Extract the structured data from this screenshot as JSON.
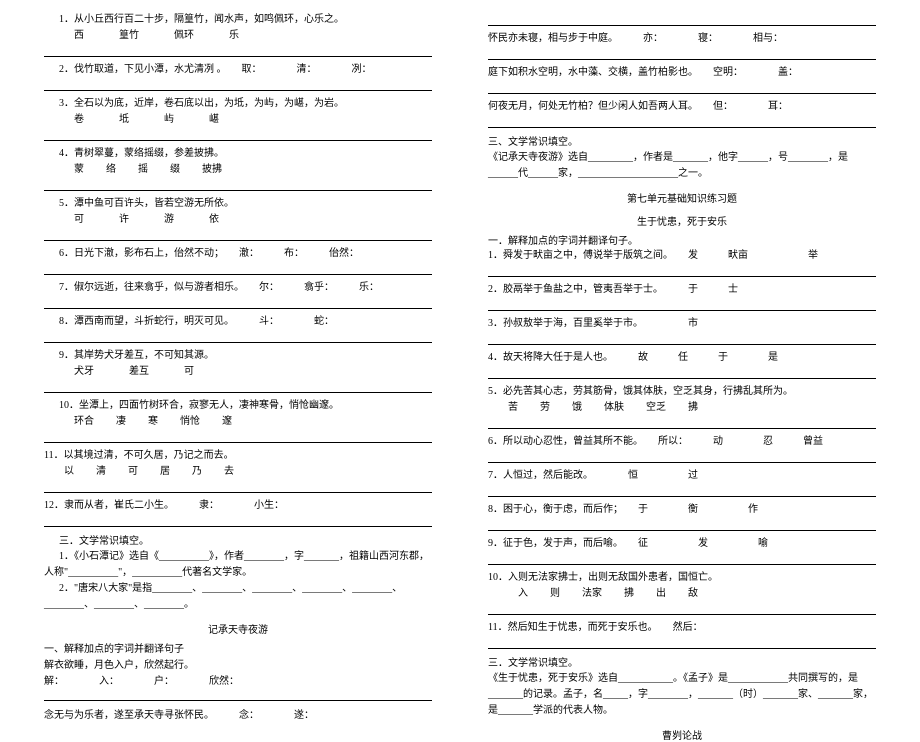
{
  "left": {
    "q1": {
      "text": "1．从小丘西行百二十步，隔篁竹，闻水声，如鸣佩环，心乐之。",
      "sub": [
        "西",
        "篁竹",
        "佩环",
        "乐"
      ]
    },
    "q2": {
      "text": "2．伐竹取道，下见小潭，水尤清冽 。　　取：　　　　清：　　　　冽：",
      "sub": []
    },
    "q3": {
      "text": "3．全石以为底，近岸，卷石底以出，为坻，为屿，为嵁，为岩。",
      "sub": [
        "卷",
        "坻",
        "屿",
        "嵁"
      ]
    },
    "q4": {
      "text": "4．青树翠蔓，蒙络摇缀，参差披拂。",
      "sub": [
        "蒙",
        "络",
        "摇",
        "缀",
        "披拂"
      ]
    },
    "q5": {
      "text": "5．潭中鱼可百许头，皆若空游无所依。",
      "sub": [
        "可",
        "许",
        "游",
        "依"
      ]
    },
    "q6": {
      "text": "6．日光下澈，影布石上，佁然不动；　　澈：　　　布：　　　佁然：",
      "sub": []
    },
    "q7": {
      "text": "7．俶尔远逝，往来翕乎，似与游者相乐。　　尔：　　　翕乎：　　　乐：",
      "sub": []
    },
    "q8": {
      "text": "8．潭西南而望，斗折蛇行，明灭可见。　　　斗：　　　　蛇：",
      "sub": []
    },
    "q9": {
      "text": "9．其岸势犬牙差互，不可知其源。",
      "sub": [
        "犬牙",
        "差互",
        "可"
      ]
    },
    "q10": {
      "text": "10．坐潭上，四面竹树环合，寂寥无人，凄神寒骨，悄怆幽邃。",
      "sub": [
        "环合",
        "凄",
        "寒",
        "悄怆",
        "邃"
      ]
    },
    "q11": {
      "text": "11．以其境过清，不可久居，乃记之而去。",
      "sub": [
        "以",
        "清",
        "可",
        "居",
        "乃",
        "去"
      ]
    },
    "q12": {
      "text": "12．隶而从者，崔氏二小生。　　　隶：　　　　小生：",
      "sub": []
    },
    "lit_h": "三．文学常识填空。",
    "lit1": "1．《小石潭记》选自《__________》，作者________，字_______，祖籍山西河东郡，人称\"__________\"，__________代著名文学家。",
    "lit2": "2．\"唐宋八大家\"是指________、________、________、________、________、________、________、________。",
    "title2": "记承天寺夜游",
    "s1": "一、解释加点的字词并翻译句子",
    "s2": "解衣欲睡，月色入户，欣然起行。",
    "s3_labels": "解：　　　　入：　　　　户：　　　　欣然：",
    "s4": "念无与为乐者，遂至承天寺寻张怀民。　　　念：　　　　遂："
  },
  "right": {
    "r1": {
      "text": "怀民亦未寝，相与步于中庭。　　　亦：　　　　寝：　　　　相与："
    },
    "r2": {
      "text": "庭下如积水空明，水中藻、交横，盖竹柏影也。　　空明：　　　　盖："
    },
    "r3": {
      "text": "何夜无月，何处无竹柏？但少闲人如吾两人耳。　　但：　　　　耳："
    },
    "lit_h": "三、文学常识填空。",
    "lit": "《记承天寺夜游》选自_________，作者是_______，他字______，号________，是______代______家，____________________之一。",
    "unit_h": "第七单元基础知识练习题",
    "title3": "生于忧患，死于安乐",
    "s1": "一．解释加点的字词并翻译句子。",
    "q1": {
      "text": "1．舜发于畎亩之中，傅说举于版筑之间。　　发　　　畎亩　　　　　　举"
    },
    "q2": {
      "text": "2．胶鬲举于鱼盐之中，管夷吾举于士。　　　于　　　士"
    },
    "q3": {
      "text": "3．孙叔敖举于海，百里奚举于市。　　　　　市"
    },
    "q4": {
      "text": "4．故天将降大任于是人也。　　　故　　　任　　　于　　　　是"
    },
    "q5": {
      "text": "5．必先苦其心志，劳其筋骨，饿其体肤，空乏其身，行拂乱其所为。",
      "sub": [
        "苦",
        "劳",
        "饿",
        "体肤",
        "空乏",
        "拂"
      ]
    },
    "q6": {
      "text": "6．所以动心忍性，曾益其所不能。　　所以：　　　动　　　　忍　　　曾益"
    },
    "q7": {
      "text": "7．人恒过，然后能改。　　　　恒　　　　　过"
    },
    "q8": {
      "text": "8．困于心，衡于虑，而后作；　　于　　　　衡　　　　　作"
    },
    "q9": {
      "text": "9．征于色，发于声，而后喻。　　征　　　　　发　　　　　喻"
    },
    "q10": {
      "text": "10．入则无法家拂士，出则无敌国外患者，国恒亡。",
      "sub": [
        "入",
        "则",
        "法家",
        "拂",
        "出",
        "敌"
      ]
    },
    "q11": {
      "text": "11．然后知生于忧患，而死于安乐也。　　然后："
    },
    "lit2_h": "三．文学常识填空。",
    "lit2": "《生于忧患，死于安乐》选自___________。《孟子》是____________共同撰写的，是_______的记录。孟子，名_____，字________，_______（时）_______家、_______家，是_______学派的代表人物。",
    "title4": "曹刿论战"
  }
}
